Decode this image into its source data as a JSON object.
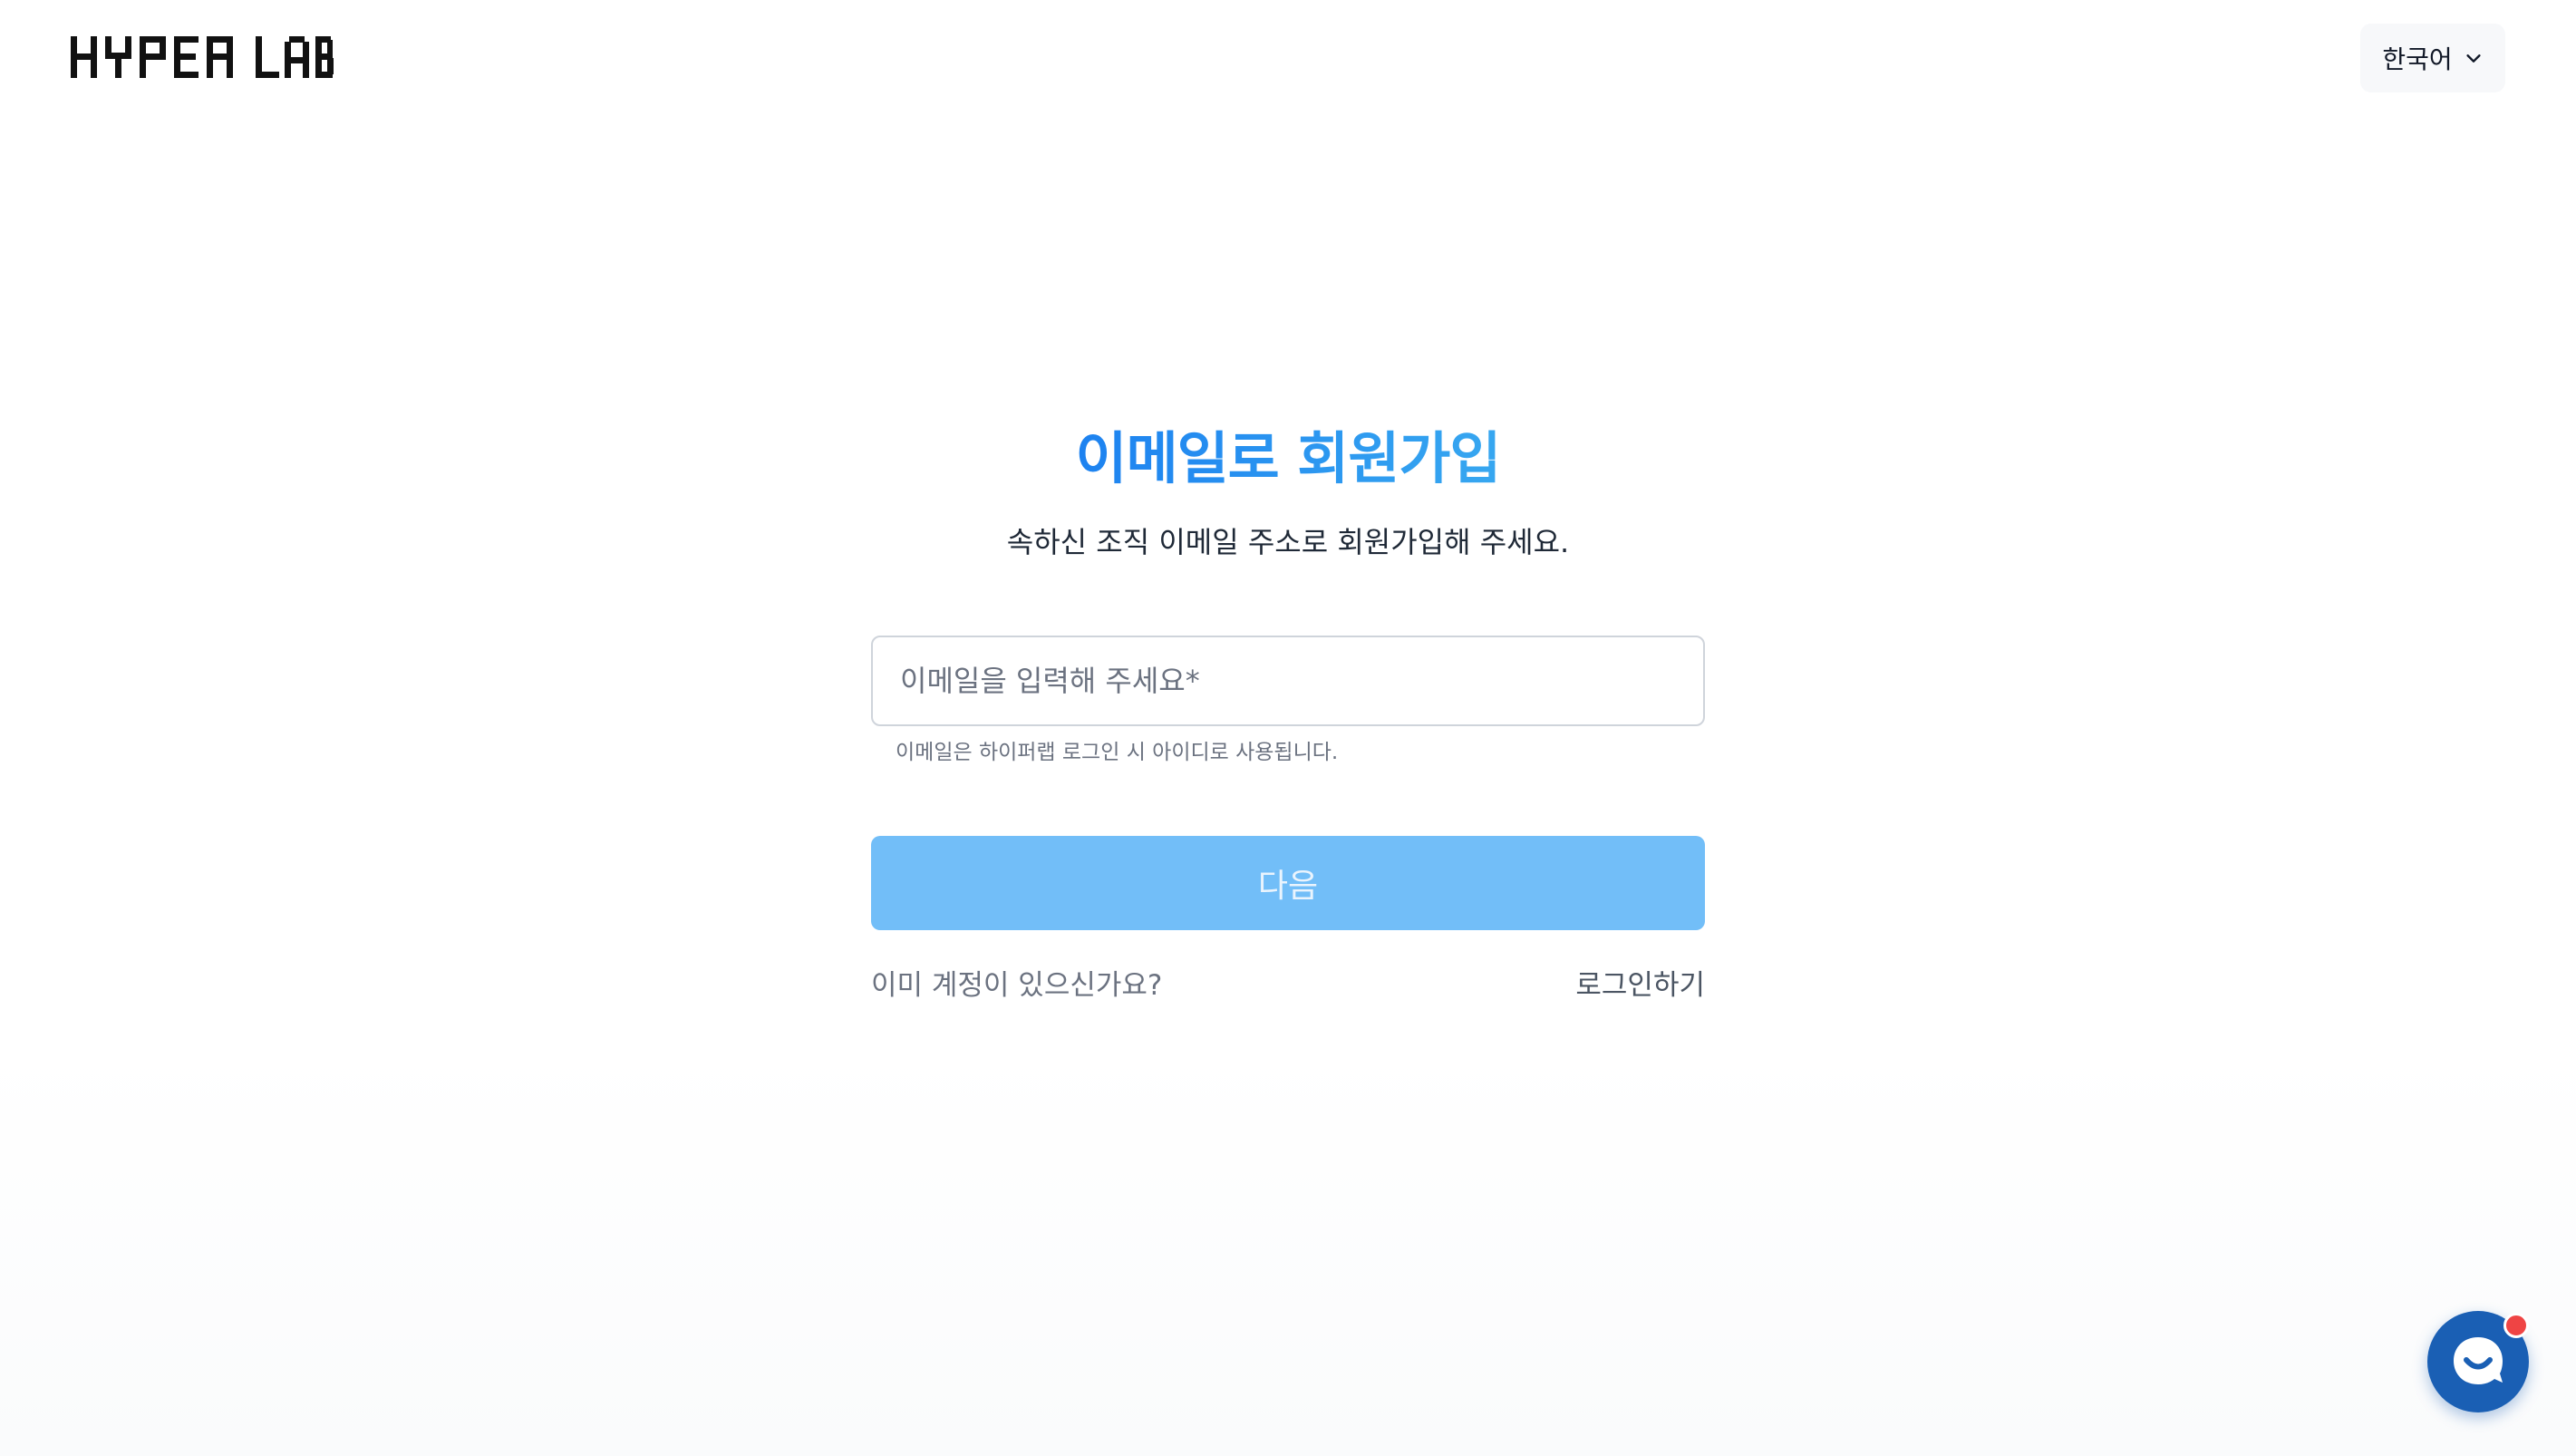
{
  "header": {
    "logo_text": "HYPER LAB",
    "language": {
      "selected": "한국어",
      "icon": "chevron-down-icon"
    }
  },
  "signup": {
    "title": "이메일로 회원가입",
    "subtitle": "속하신 조직 이메일 주소로 회원가입해 주세요.",
    "email_field": {
      "placeholder": "이메일을 입력해 주세요*",
      "value": ""
    },
    "helper_text": "이메일은 하이퍼랩 로그인 시 아이디로 사용됩니다.",
    "next_button_label": "다음",
    "already_account_text": "이미 계정이 있으신가요?",
    "login_link_label": "로그인하기"
  },
  "chat_widget": {
    "icon": "chat-bubble-icon",
    "has_notification": true
  },
  "colors": {
    "title_gradient_start": "#1d82f0",
    "title_gradient_end": "#37a7f0",
    "primary_button_disabled": "#72bef8",
    "chat_button": "#1a5fb4",
    "notification_dot": "#ef4444"
  }
}
